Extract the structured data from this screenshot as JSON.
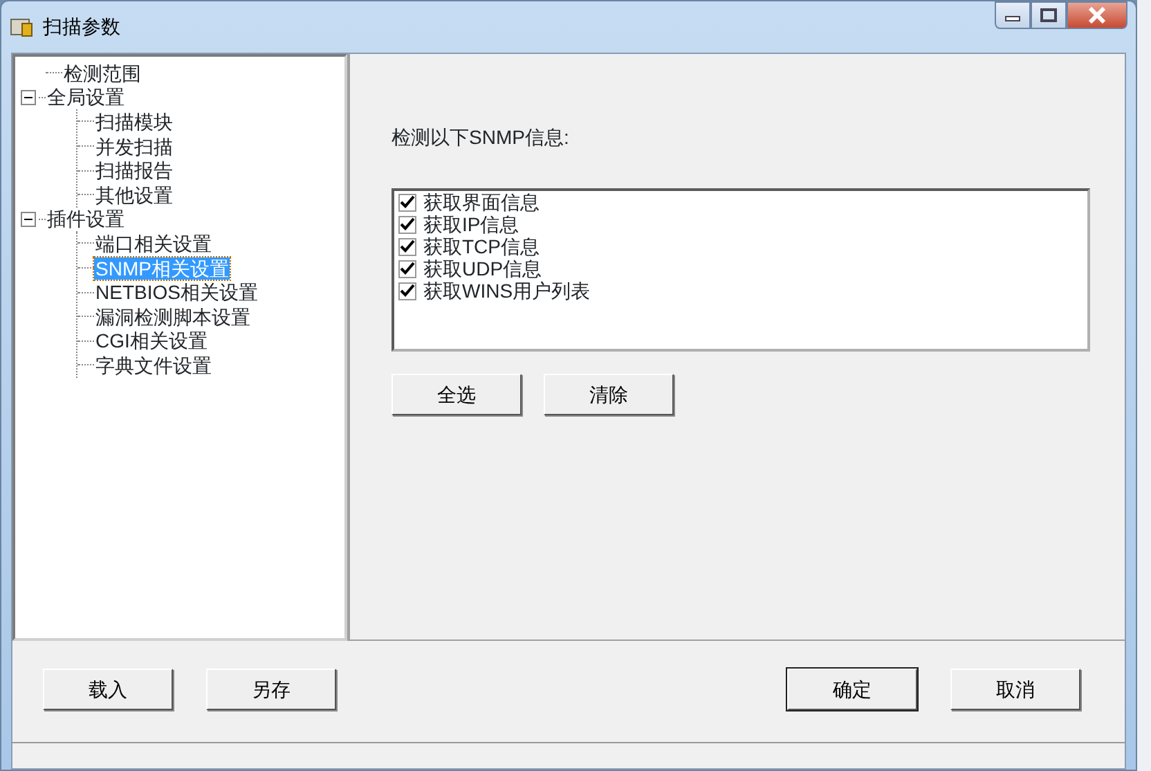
{
  "window": {
    "title": "扫描参数"
  },
  "tree": [
    {
      "label": "检测范围",
      "selected": false
    },
    {
      "label": "全局设置",
      "selected": false,
      "expanded": true,
      "children": [
        {
          "label": "扫描模块",
          "selected": false
        },
        {
          "label": "并发扫描",
          "selected": false
        },
        {
          "label": "扫描报告",
          "selected": false
        },
        {
          "label": "其他设置",
          "selected": false
        }
      ]
    },
    {
      "label": "插件设置",
      "selected": false,
      "expanded": true,
      "children": [
        {
          "label": "端口相关设置",
          "selected": false
        },
        {
          "label": "SNMP相关设置",
          "selected": true
        },
        {
          "label": "NETBIOS相关设置",
          "selected": false
        },
        {
          "label": "漏洞检测脚本设置",
          "selected": false
        },
        {
          "label": "CGI相关设置",
          "selected": false
        },
        {
          "label": "字典文件设置",
          "selected": false
        }
      ]
    }
  ],
  "panel": {
    "heading": "检测以下SNMP信息:",
    "options": [
      {
        "label": "获取界面信息",
        "checked": true
      },
      {
        "label": "获取IP信息",
        "checked": true
      },
      {
        "label": "获取TCP信息",
        "checked": true
      },
      {
        "label": "获取UDP信息",
        "checked": true
      },
      {
        "label": "获取WINS用户列表",
        "checked": true
      }
    ],
    "buttons": [
      "全选",
      "清除"
    ]
  },
  "footer": {
    "left_buttons": [
      "载入",
      "另存"
    ],
    "right_buttons": [
      {
        "label": "确定",
        "default": true
      },
      {
        "label": "取消",
        "default": false
      }
    ]
  }
}
